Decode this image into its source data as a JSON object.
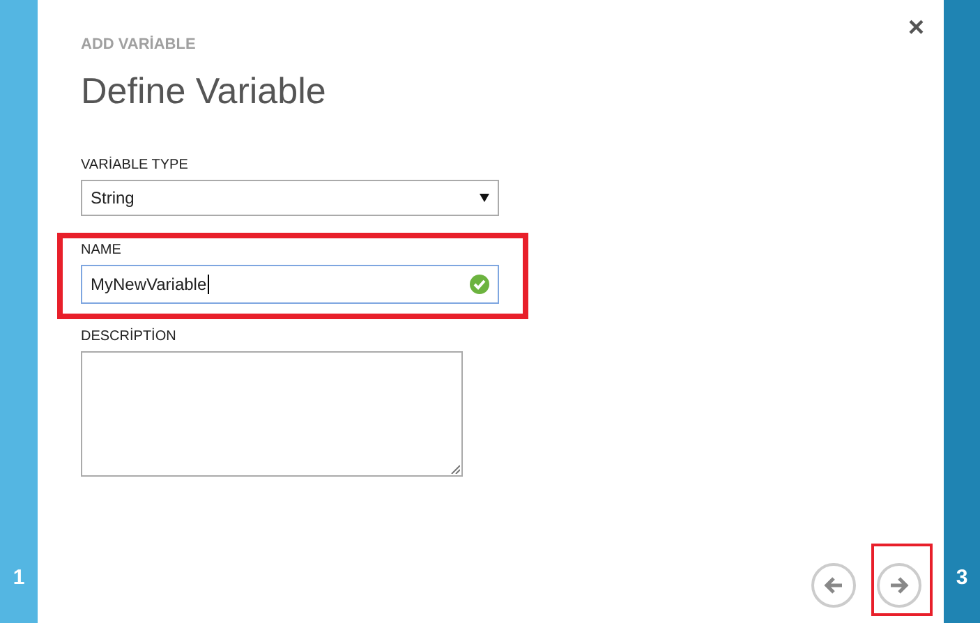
{
  "steps": {
    "previous": "1",
    "next": "3"
  },
  "dialog": {
    "subtitle": "ADD VARİABLE",
    "title": "Define Variable",
    "close": "×"
  },
  "fields": [
    {
      "kind": "select",
      "label": "VARİABLE TYPE",
      "value": "String",
      "highlighted": false
    },
    {
      "kind": "text",
      "label": "NAME",
      "value": "MyNewVariable",
      "valid": true,
      "focused": true,
      "highlighted": true
    },
    {
      "kind": "textarea",
      "label": "DESCRİPTİON",
      "highlighted": false
    }
  ],
  "nav": [
    {
      "kind": "back",
      "highlighted": false
    },
    {
      "kind": "next",
      "highlighted": true
    }
  ]
}
